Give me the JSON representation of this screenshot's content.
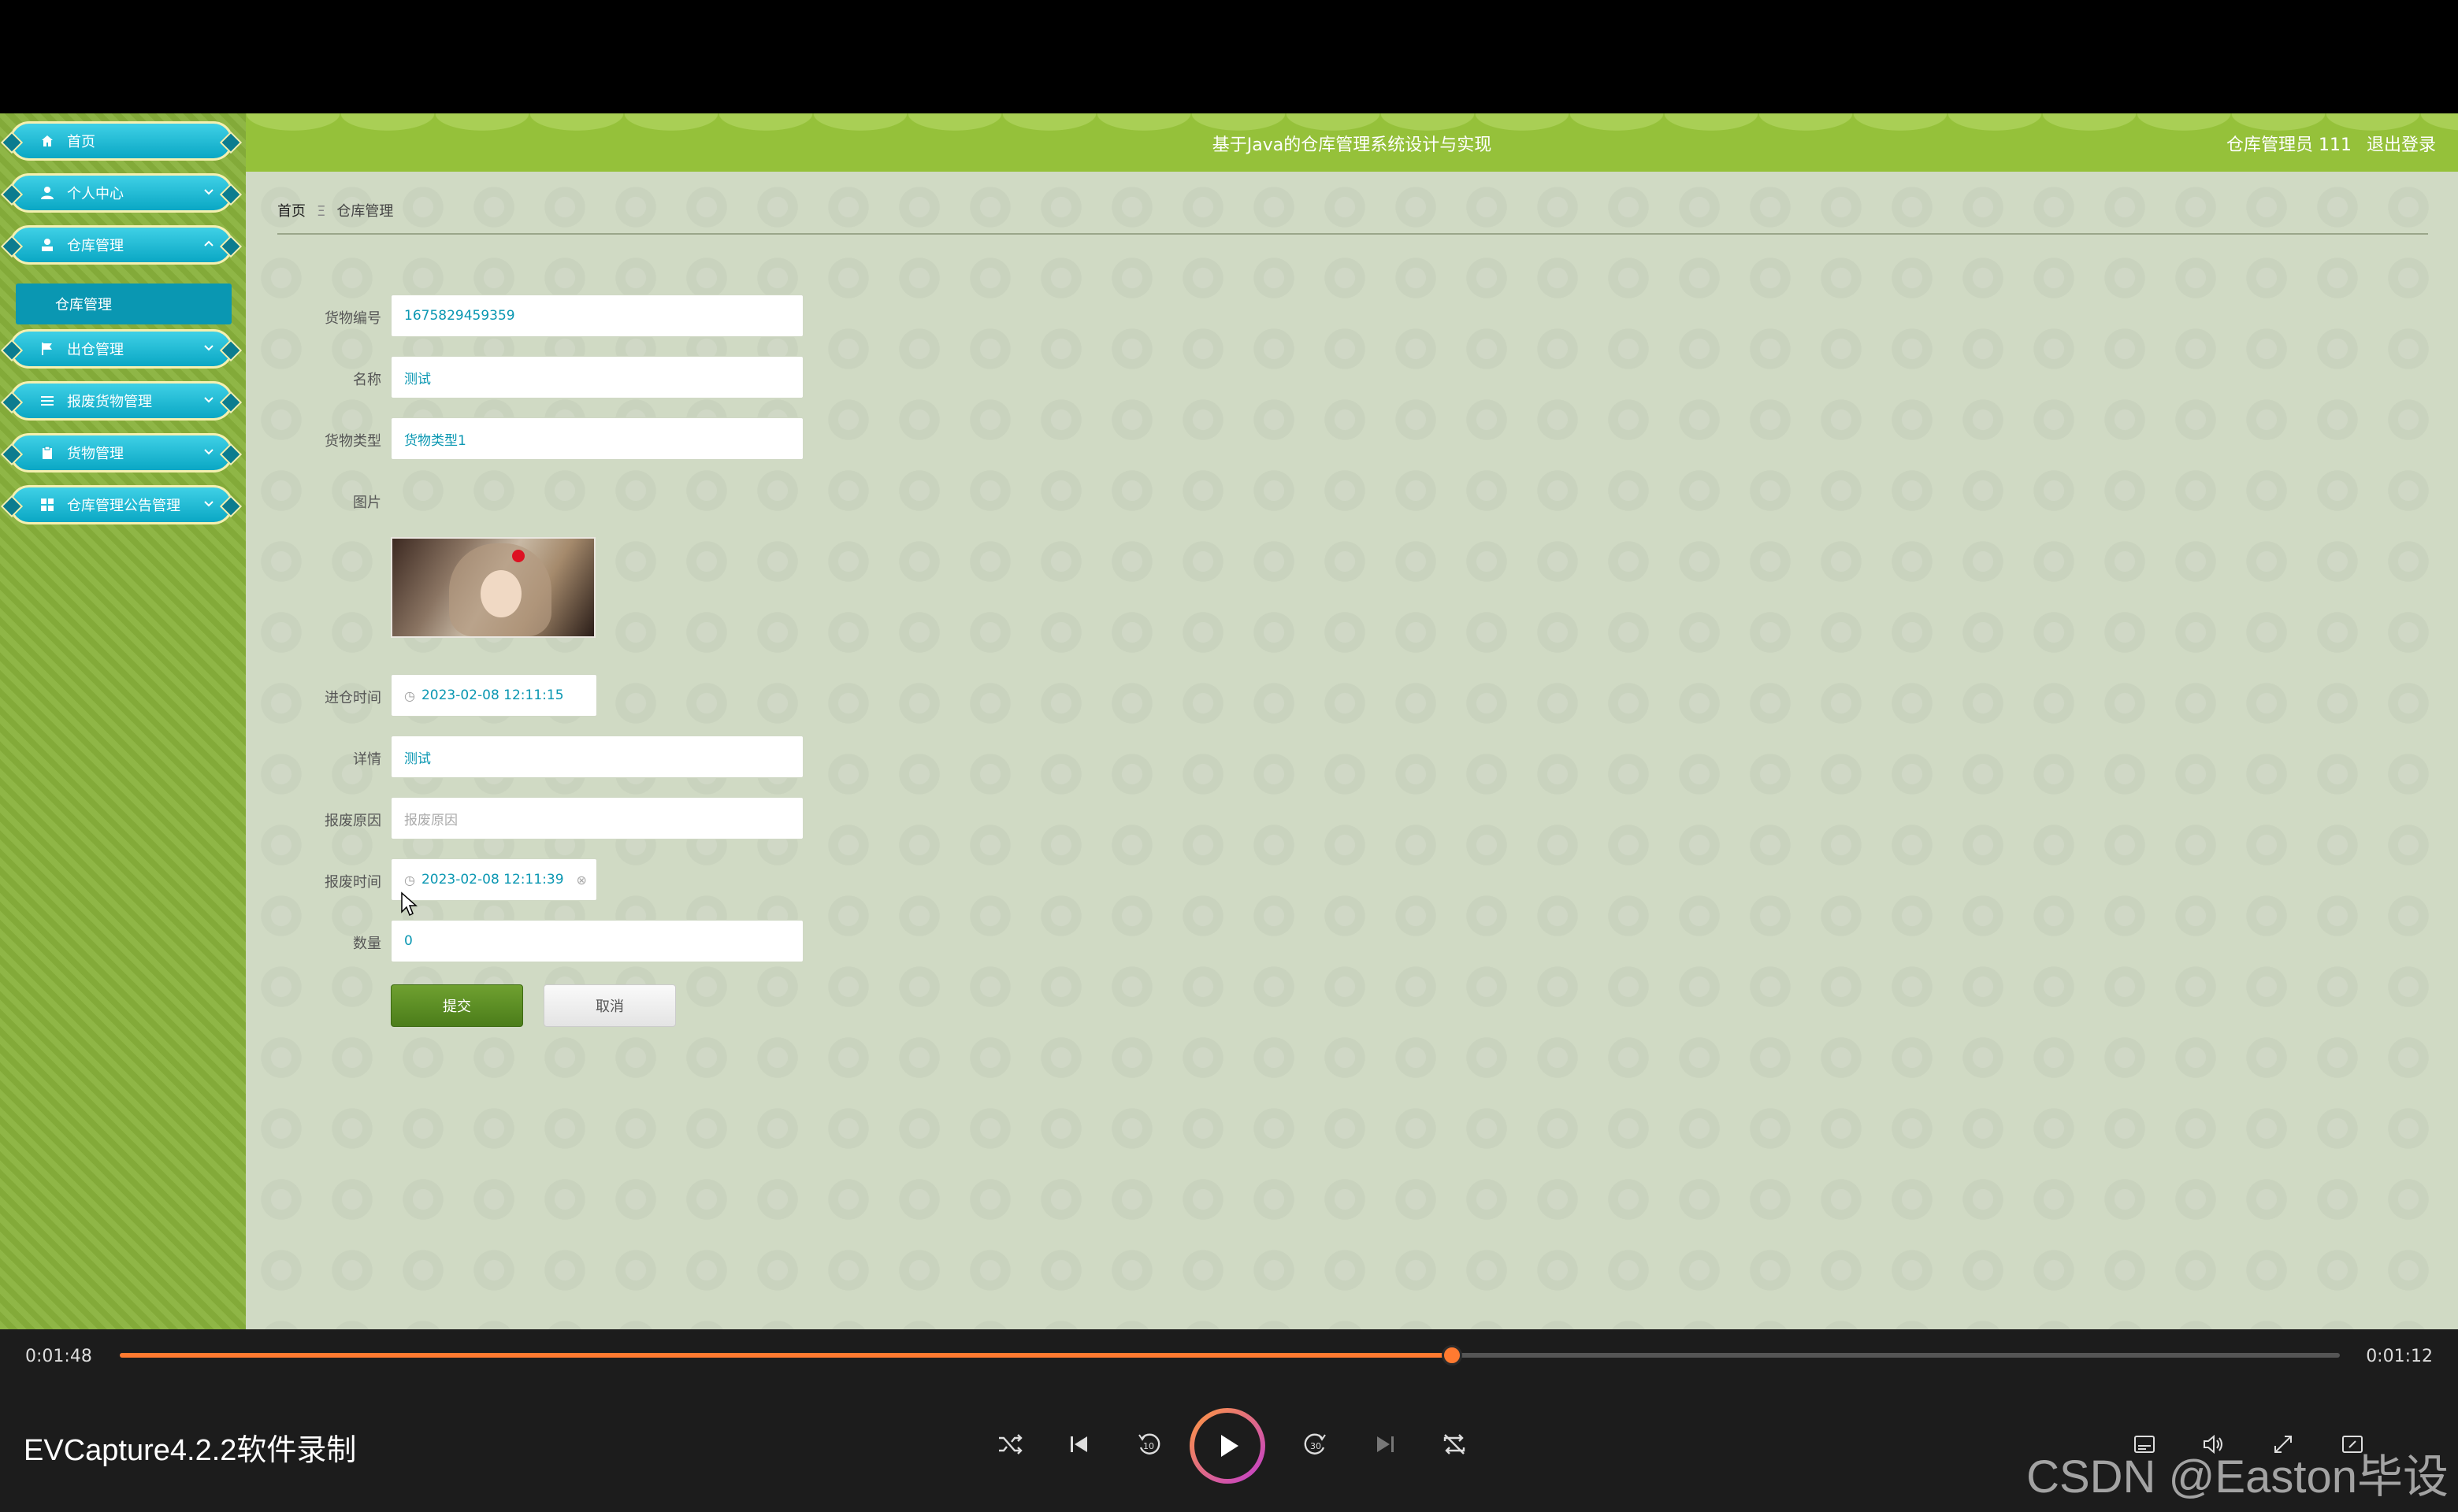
{
  "app": {
    "title": "基于Java的仓库管理系统设计与实现",
    "user_label": "仓库管理员 111",
    "logout_label": "退出登录"
  },
  "sidebar": {
    "items": [
      {
        "label": "首页",
        "icon": "home-icon"
      },
      {
        "label": "个人中心",
        "icon": "user-icon"
      },
      {
        "label": "仓库管理",
        "icon": "warehouse-icon"
      },
      {
        "label": "出仓管理",
        "icon": "flag-icon"
      },
      {
        "label": "报废货物管理",
        "icon": "list-icon"
      },
      {
        "label": "货物管理",
        "icon": "clipboard-icon"
      },
      {
        "label": "仓库管理公告管理",
        "icon": "grid-icon"
      }
    ],
    "subitem": "仓库管理"
  },
  "breadcrumb": {
    "home": "首页",
    "sep": "Ξ",
    "current": "仓库管理"
  },
  "form": {
    "goods_no_label": "货物编号",
    "goods_no_value": "1675829459359",
    "name_label": "名称",
    "name_value": "测试",
    "type_label": "货物类型",
    "type_value": "货物类型1",
    "image_label": "图片",
    "in_time_label": "进仓时间",
    "in_time_value": "2023-02-08 12:11:15",
    "detail_label": "详情",
    "detail_value": "测试",
    "scrap_reason_label": "报废原因",
    "scrap_reason_placeholder": "报废原因",
    "scrap_time_label": "报废时间",
    "scrap_time_value": "2023-02-08 12:11:39",
    "qty_label": "数量",
    "qty_value": "0",
    "submit_label": "提交",
    "cancel_label": "取消"
  },
  "player": {
    "current_time": "0:01:48",
    "remaining_time": "0:01:12",
    "progress": 0.6,
    "recorder_label": "EVCapture4.2.2软件录制",
    "watermark": "CSDN @Easton毕设",
    "accent": "#ff7a30"
  }
}
